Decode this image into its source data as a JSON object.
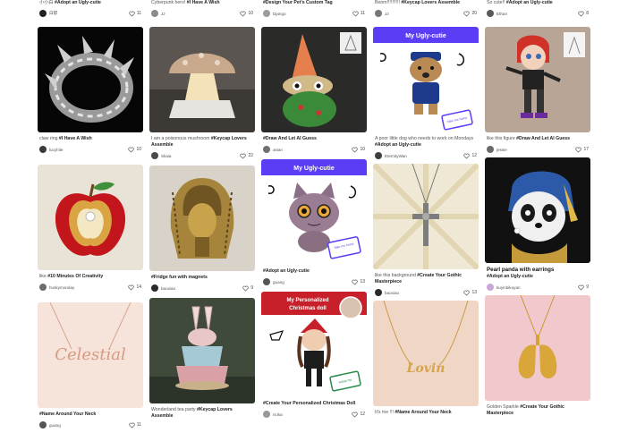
{
  "top_row": [
    {
      "caption_plain": "小小白 ",
      "caption_tag": "#Adopt an Ugly-cutie",
      "user": "白郁",
      "likes": "11"
    },
    {
      "caption_plain": "Cyberpunk hero! ",
      "caption_tag": "#I Have A Wish",
      "user": "JJ",
      "likes": "10"
    },
    {
      "caption_plain": "",
      "caption_tag": "#Design Your Pet's Custom Tag",
      "user": "Django",
      "likes": "11"
    },
    {
      "caption_plain": "Beom!!!!!!!!!! ",
      "caption_tag": "#Keycap Lovers Assemble",
      "user": "JJ",
      "likes": "20"
    },
    {
      "caption_plain": "So cute!! ",
      "caption_tag": "#Adopt an Ugly-cutie",
      "user": "Ethan",
      "likes": "8"
    }
  ],
  "columns": [
    [
      {
        "caption_plain": "claw ring ",
        "caption_tag": "#I Have A Wish",
        "user": "lucyhile",
        "likes": "10"
      },
      {
        "caption_plain": "like ",
        "caption_tag": "#10 Minutes Of Creativity",
        "user": "huskymonday",
        "likes": "14"
      },
      {
        "caption_plain": "",
        "caption_tag": "#Name Around Your Neck",
        "user": "guang",
        "likes": "11"
      }
    ],
    [
      {
        "caption_plain": "I am a poisonous mushroom ",
        "caption_tag": "#Keycap Lovers Assemble",
        "user": "Skaia",
        "likes": "22"
      },
      {
        "caption_plain": "",
        "caption_tag": "#Fridge fun with magnets",
        "user": "baoxiao",
        "likes": "9"
      },
      {
        "caption_plain": "Wonderland tea party ",
        "caption_tag": "#Keycap Lovers Assemble",
        "user": "",
        "likes": ""
      }
    ],
    [
      {
        "caption_plain": "",
        "caption_tag": "#Draw And Let AI Guess",
        "user": "asian",
        "likes": "10"
      },
      {
        "caption_plain": "",
        "caption_tag": "#Adopt an Ugly-cutie",
        "user": "guang",
        "likes": "13"
      },
      {
        "caption_plain": "",
        "caption_tag": "#Create Your Personalized Christmas Doll",
        "user": "ricika",
        "likes": "12"
      }
    ],
    [
      {
        "caption_plain": "A poor little dog who needs to work on Mondays ",
        "caption_tag": "#Adopt an Ugly-cutie",
        "user": "EternityWan",
        "likes": "12"
      },
      {
        "caption_plain": "like this background ",
        "caption_tag": "#Create Your Gothic Masterpiece",
        "user": "baoxiao",
        "likes": "13"
      },
      {
        "caption_plain": "It's me !!! ",
        "caption_tag": "#Name Around Your Neck",
        "user": "",
        "likes": ""
      }
    ],
    [
      {
        "caption_plain": "like this figure ",
        "caption_tag": "#Draw And Let AI Guess",
        "user": "jessie",
        "likes": "17"
      },
      {
        "title": "Pearl panda with earrings",
        "caption_plain": "",
        "caption_tag": "#Adopt an Ugly-cutie",
        "user": "kuyinbikuyan",
        "likes": "9"
      },
      {
        "caption_plain": "Golden Sparkle ",
        "caption_tag": "#Create Your Gothic Masterpiece",
        "user": "",
        "likes": ""
      }
    ]
  ],
  "overlay_text": {
    "ugly_cutie_banner": "My Ugly-cutie",
    "take_home": "Take me home",
    "adopt_me": "Adopt me",
    "christmas_banner_line1": "My Personalized",
    "christmas_banner_line2": "Christmas doll",
    "necklace_celestial": "Celestial",
    "necklace_name": "Lovin"
  },
  "colors": {
    "accent_purple": "#5b3df5",
    "christmas_red": "#c8202a",
    "heart_outline": "#555555"
  }
}
